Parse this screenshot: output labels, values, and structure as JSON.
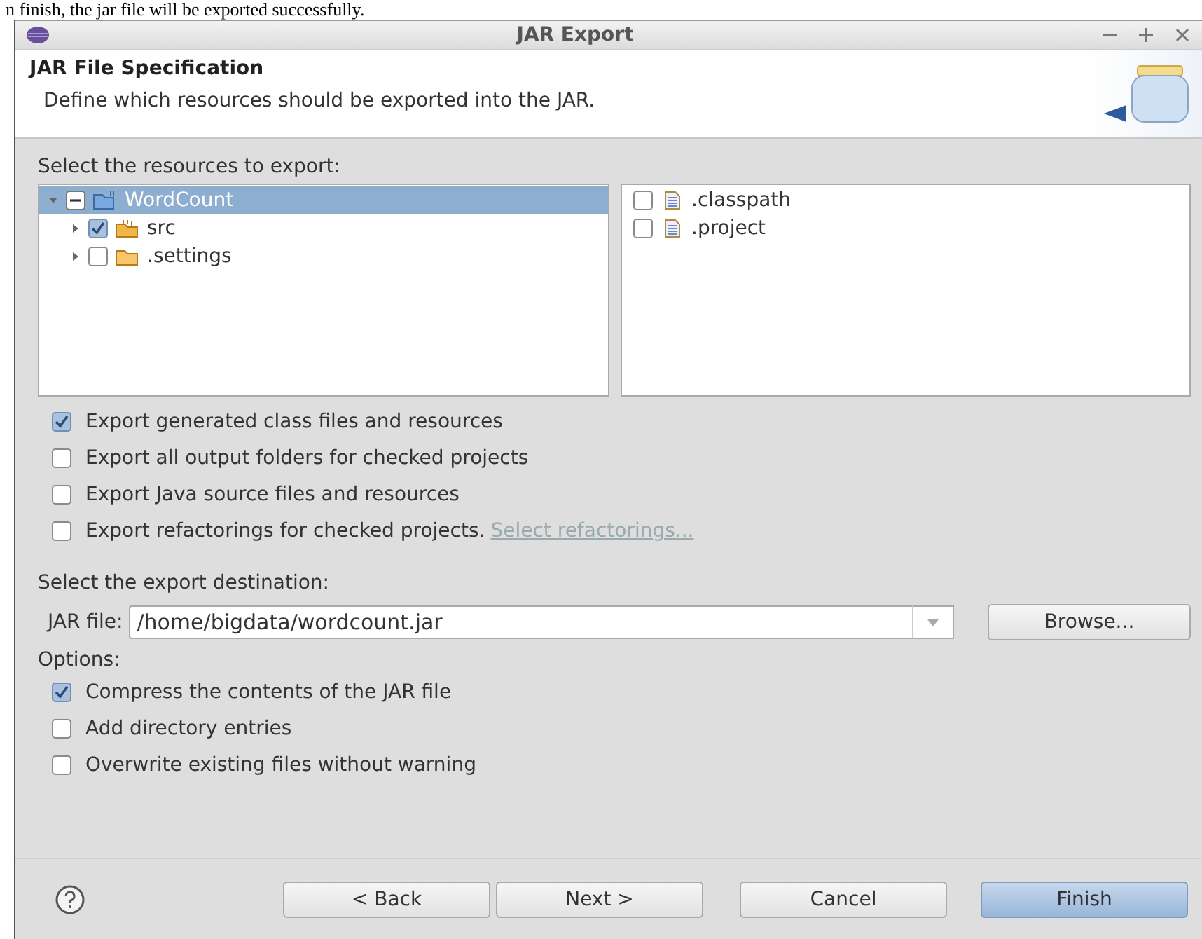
{
  "document_text": "n finish, the jar file will be exported successfully.",
  "window": {
    "title": "JAR Export"
  },
  "header": {
    "title": "JAR File Specification",
    "description": "Define which resources should be exported into the JAR."
  },
  "resources": {
    "label": "Select the resources to export:",
    "tree": [
      {
        "label": "WordCount",
        "kind": "project",
        "checked": false,
        "mixed": true,
        "expanded": true,
        "selected": true,
        "children": [
          {
            "label": "src",
            "kind": "source",
            "checked": true,
            "mixed": false,
            "expanded": false,
            "selected": false
          },
          {
            "label": ".settings",
            "kind": "folder",
            "checked": false,
            "mixed": false,
            "expanded": false,
            "selected": false
          }
        ]
      }
    ],
    "files": [
      {
        "label": ".classpath",
        "checked": false
      },
      {
        "label": ".project",
        "checked": false
      }
    ]
  },
  "export_options": [
    {
      "label": "Export generated class files and resources",
      "checked": true
    },
    {
      "label": "Export all output folders for checked projects",
      "checked": false
    },
    {
      "label": "Export Java source files and resources",
      "checked": false
    },
    {
      "label": "Export refactorings for checked projects.",
      "checked": false,
      "link": "Select refactorings..."
    }
  ],
  "destination": {
    "label": "Select the export destination:",
    "field_label": "JAR file:",
    "value": "/home/bigdata/wordcount.jar",
    "browse": "Browse..."
  },
  "options": {
    "label": "Options:",
    "items": [
      {
        "label": "Compress the contents of the JAR file",
        "checked": true
      },
      {
        "label": "Add directory entries",
        "checked": false
      },
      {
        "label": "Overwrite existing files without warning",
        "checked": false
      }
    ]
  },
  "buttons": [
    {
      "label": "< Back",
      "default": false
    },
    {
      "label": "Next >",
      "default": false
    },
    {
      "label": "Cancel",
      "default": false
    },
    {
      "label": "Finish",
      "default": true
    }
  ]
}
